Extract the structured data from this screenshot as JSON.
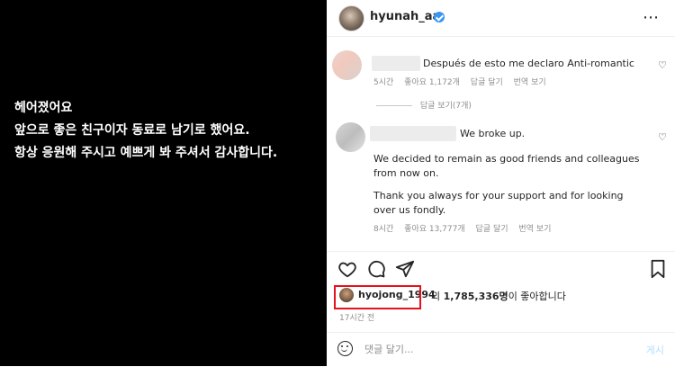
{
  "post": {
    "caption_lines": [
      "헤어졌어요",
      "앞으로 좋은 친구이자 동료로 남기로 했어요.",
      "항상 응원해 주시고 예쁘게 봐 주셔서 감사합니다."
    ]
  },
  "header": {
    "username": "hyunah_aa",
    "close_label": "⋯"
  },
  "comments": [
    {
      "text": "Después de esto me declaro Anti-romantic",
      "time": "5시간",
      "likes": "좋아요 1,172개",
      "reply": "답글 달기",
      "translate": "번역 보기",
      "view_replies": "답글 보기(7개)"
    },
    {
      "text_lines": [
        "We broke up.",
        "",
        "We decided to remain as good friends and colleagues from now on.",
        "",
        "Thank you always for your support and for looking over us fondly."
      ],
      "time": "8시간",
      "likes": "좋아요 13,777개",
      "reply": "답글 달기",
      "translate": "번역 보기"
    }
  ],
  "likes": {
    "liker": "hyojong_1994",
    "others_prefix": "외",
    "count": "1,785,336명",
    "suffix": "이 좋아합니다"
  },
  "timeago": "17시간 전",
  "comment_box": {
    "placeholder": "댓글 달기...",
    "post_label": "게시"
  },
  "icons": [
    "heart-icon",
    "comment-icon",
    "share-icon",
    "bookmark-icon",
    "emoji-icon",
    "verified-icon",
    "more-icon"
  ],
  "colors": {
    "highlight": "#e8101a",
    "verified": "#3897f0",
    "link_disabled": "#b2dffc"
  }
}
